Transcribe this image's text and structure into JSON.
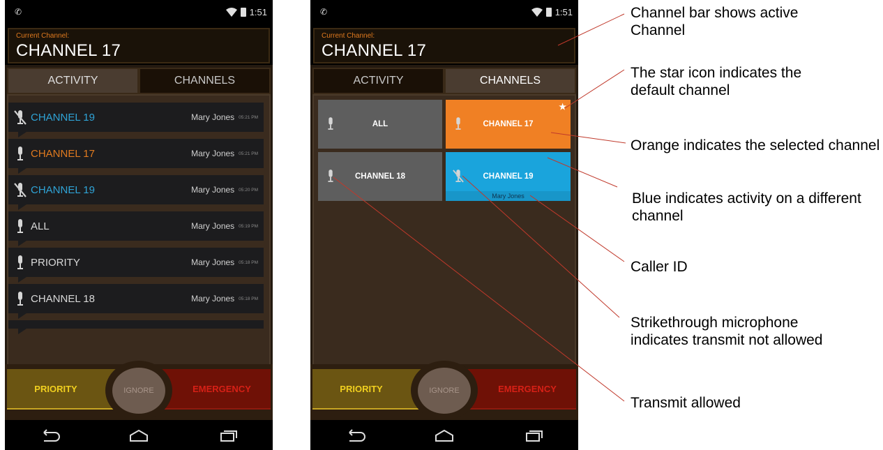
{
  "status_bar": {
    "time": "1:51"
  },
  "channel_bar": {
    "label": "Current Channel:",
    "value": "CHANNEL 17"
  },
  "tabs": {
    "activity": "ACTIVITY",
    "channels": "CHANNELS"
  },
  "activity": [
    {
      "channel": "CHANNEL 19",
      "color": "#2fa3d6",
      "transmit_allowed": false,
      "who": "Mary Jones",
      "time": "05:21 PM"
    },
    {
      "channel": "CHANNEL 17",
      "color": "#e07a1f",
      "transmit_allowed": true,
      "who": "Mary Jones",
      "time": "05:21 PM"
    },
    {
      "channel": "CHANNEL 19",
      "color": "#2fa3d6",
      "transmit_allowed": false,
      "who": "Mary Jones",
      "time": "05:20 PM"
    },
    {
      "channel": "ALL",
      "color": "#d8d8d8",
      "transmit_allowed": true,
      "who": "Mary Jones",
      "time": "05:19 PM"
    },
    {
      "channel": "PRIORITY",
      "color": "#d8d8d8",
      "transmit_allowed": true,
      "who": "Mary Jones",
      "time": "05:18 PM"
    },
    {
      "channel": "CHANNEL 18",
      "color": "#d8d8d8",
      "transmit_allowed": true,
      "who": "Mary Jones",
      "time": "05:18 PM"
    }
  ],
  "channels": [
    {
      "label": "ALL",
      "state": "gray",
      "transmit_allowed": true
    },
    {
      "label": "CHANNEL 17",
      "state": "orange",
      "transmit_allowed": true,
      "default": true
    },
    {
      "label": "CHANNEL 18",
      "state": "gray",
      "transmit_allowed": true
    },
    {
      "label": "CHANNEL 19",
      "state": "blue",
      "transmit_allowed": false,
      "caller": "Mary Jones"
    }
  ],
  "actions": {
    "priority": "PRIORITY",
    "ignore": "IGNORE",
    "emergency": "EMERGENCY"
  },
  "callouts": {
    "channel_bar": "Channel bar shows active Channel",
    "star": "The star icon indicates the default channel",
    "orange": "Orange indicates the selected channel",
    "blue": "Blue indicates activity on a different channel",
    "caller": "Caller ID",
    "strikethrough": "Strikethrough microphone indicates transmit not allowed",
    "transmit": "Transmit allowed"
  },
  "colors": {
    "orange_selected": "#f08024",
    "blue_activity": "#1aa4dc",
    "priority_text": "#f0cf1f",
    "emergency_text": "#d62016"
  }
}
